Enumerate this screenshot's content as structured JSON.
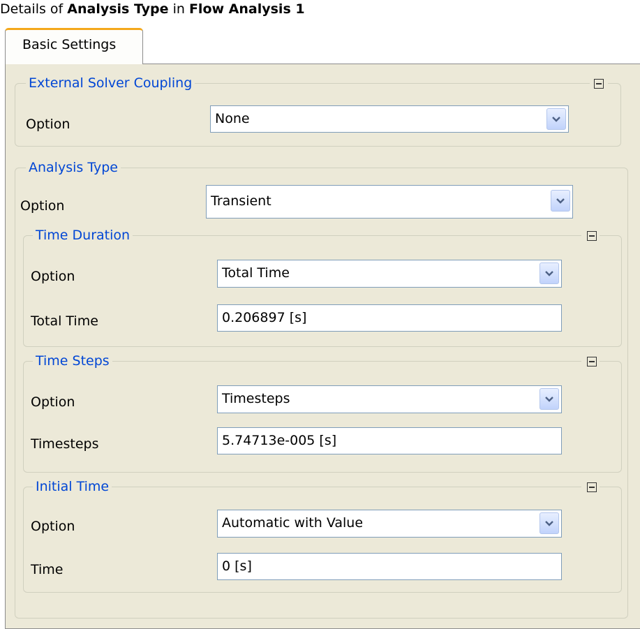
{
  "header": {
    "prefix": "Details of ",
    "object": "Analysis Type",
    "mid": " in ",
    "analysis": "Flow Analysis 1"
  },
  "tabs": [
    {
      "label": "Basic Settings",
      "active": true
    }
  ],
  "groups": {
    "external_solver": {
      "legend": "External Solver Coupling",
      "option_label": "Option",
      "option_value": "None"
    },
    "analysis_type": {
      "legend": "Analysis Type",
      "option_label": "Option",
      "option_value": "Transient",
      "time_duration": {
        "legend": "Time Duration",
        "option_label": "Option",
        "option_value": "Total Time",
        "field_label": "Total Time",
        "field_value": "0.206897 [s]"
      },
      "time_steps": {
        "legend": "Time Steps",
        "option_label": "Option",
        "option_value": "Timesteps",
        "field_label": "Timesteps",
        "field_value": "5.74713e-005 [s]"
      },
      "initial_time": {
        "legend": "Initial Time",
        "option_label": "Option",
        "option_value": "Automatic with Value",
        "field_label": "Time",
        "field_value": "0 [s]"
      }
    }
  },
  "colors": {
    "panel_bg": "#ece9d8",
    "legend_text": "#0046d5",
    "tab_accent": "#f4a81c",
    "field_border": "#7f9db9"
  },
  "icons": {
    "collapse": "collapse-minus-icon",
    "dropdown": "chevron-down-icon"
  }
}
